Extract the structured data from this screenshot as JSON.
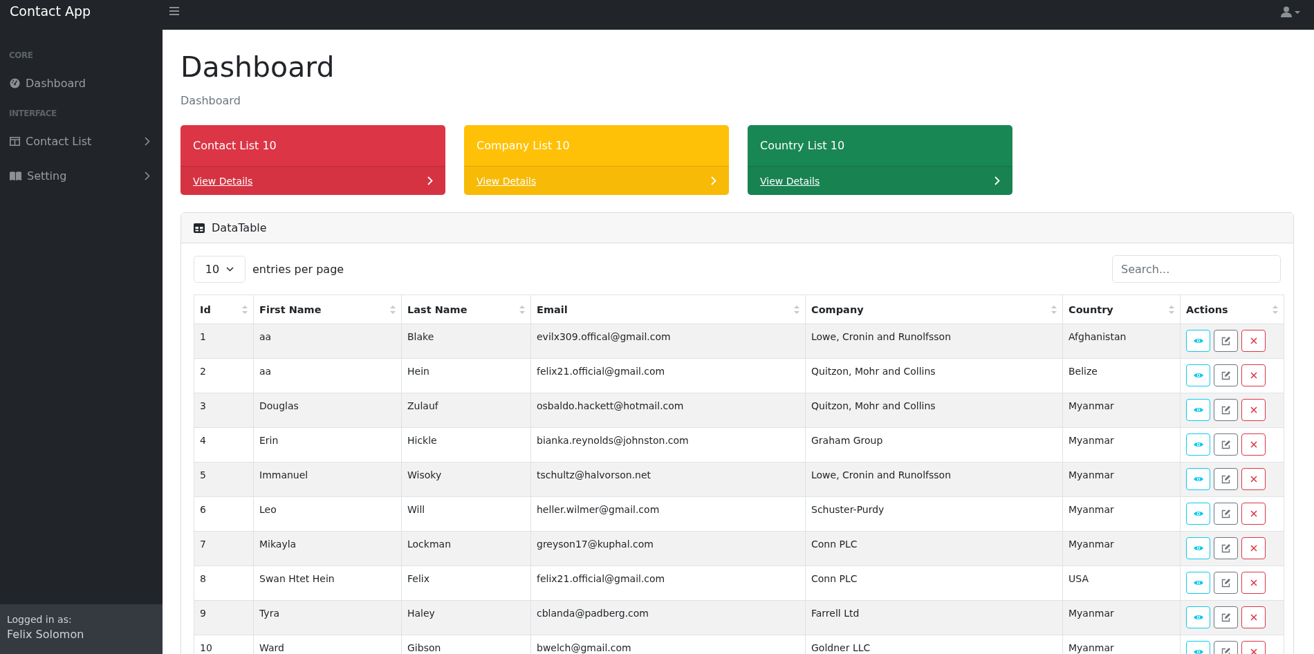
{
  "topbar": {
    "brand": "Contact App"
  },
  "sidebar": {
    "sections": [
      {
        "heading": "CORE",
        "items": [
          {
            "label": "Dashboard",
            "kind": "link"
          }
        ]
      },
      {
        "heading": "INTERFACE",
        "items": [
          {
            "label": "Contact List",
            "kind": "group",
            "expanded": false
          },
          {
            "label": "Setting",
            "kind": "group",
            "expanded": false
          }
        ]
      }
    ],
    "footer": {
      "caption": "Logged in as:",
      "user": "Felix Solomon"
    }
  },
  "page": {
    "title": "Dashboard",
    "breadcrumb": "Dashboard"
  },
  "cards": [
    {
      "title": "Contact List 10",
      "link": "View Details",
      "color": "#dc3545"
    },
    {
      "title": "Company List 10",
      "link": "View Details",
      "color": "#ffc107"
    },
    {
      "title": "Country List 10",
      "link": "View Details",
      "color": "#198754"
    }
  ],
  "datatable": {
    "title": "DataTable",
    "per_page": "10",
    "per_page_label": "entries per page",
    "search": {
      "placeholder": "Search..."
    },
    "columns": [
      "Id",
      "First Name",
      "Last Name",
      "Email",
      "Company",
      "Country",
      "Actions"
    ],
    "rows": [
      [
        "1",
        "aa",
        "Blake",
        "evilx309.offical@gmail.com",
        "Lowe, Cronin and Runolfsson",
        "Afghanistan"
      ],
      [
        "2",
        "aa",
        "Hein",
        "felix21.official@gmail.com",
        "Quitzon, Mohr and Collins",
        "Belize"
      ],
      [
        "3",
        "Douglas",
        "Zulauf",
        "osbaldo.hackett@hotmail.com",
        "Quitzon, Mohr and Collins",
        "Myanmar"
      ],
      [
        "4",
        "Erin",
        "Hickle",
        "bianka.reynolds@johnston.com",
        "Graham Group",
        "Myanmar"
      ],
      [
        "5",
        "Immanuel",
        "Wisoky",
        "tschultz@halvorson.net",
        "Lowe, Cronin and Runolfsson",
        "Myanmar"
      ],
      [
        "6",
        "Leo",
        "Will",
        "heller.wilmer@gmail.com",
        "Schuster-Purdy",
        "Myanmar"
      ],
      [
        "7",
        "Mikayla",
        "Lockman",
        "greyson17@kuphal.com",
        "Conn PLC",
        "Myanmar"
      ],
      [
        "8",
        "Swan Htet Hein",
        "Felix",
        "felix21.official@gmail.com",
        "Conn PLC",
        "USA"
      ],
      [
        "9",
        "Tyra",
        "Haley",
        "cblanda@padberg.com",
        "Farrell Ltd",
        "Myanmar"
      ],
      [
        "10",
        "Ward",
        "Gibson",
        "bwelch@gmail.com",
        "Goldner LLC",
        "Myanmar"
      ]
    ]
  }
}
